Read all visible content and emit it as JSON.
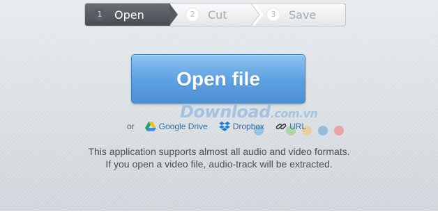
{
  "steps": [
    {
      "number": "1",
      "label": "Open",
      "active": true
    },
    {
      "number": "2",
      "label": "Cut",
      "active": false
    },
    {
      "number": "3",
      "label": "Save",
      "active": false
    }
  ],
  "main": {
    "open_button_label": "Open file"
  },
  "sources": {
    "or_label": "or",
    "links": [
      {
        "label": "Google Drive",
        "icon": "google-drive-icon"
      },
      {
        "label": "Dropbox",
        "icon": "dropbox-icon"
      },
      {
        "label": "URL",
        "icon": "link-icon"
      }
    ]
  },
  "info": {
    "line1": "This application supports almost all audio and video formats.",
    "line2": "If you open a video file, audio-track will be extracted."
  },
  "watermark": {
    "text": "Download",
    "domain": ".com.vn"
  },
  "colors": {
    "accent_button": "#5fa2e2",
    "link": "#2f6fa9",
    "active_step": "#484c52"
  }
}
